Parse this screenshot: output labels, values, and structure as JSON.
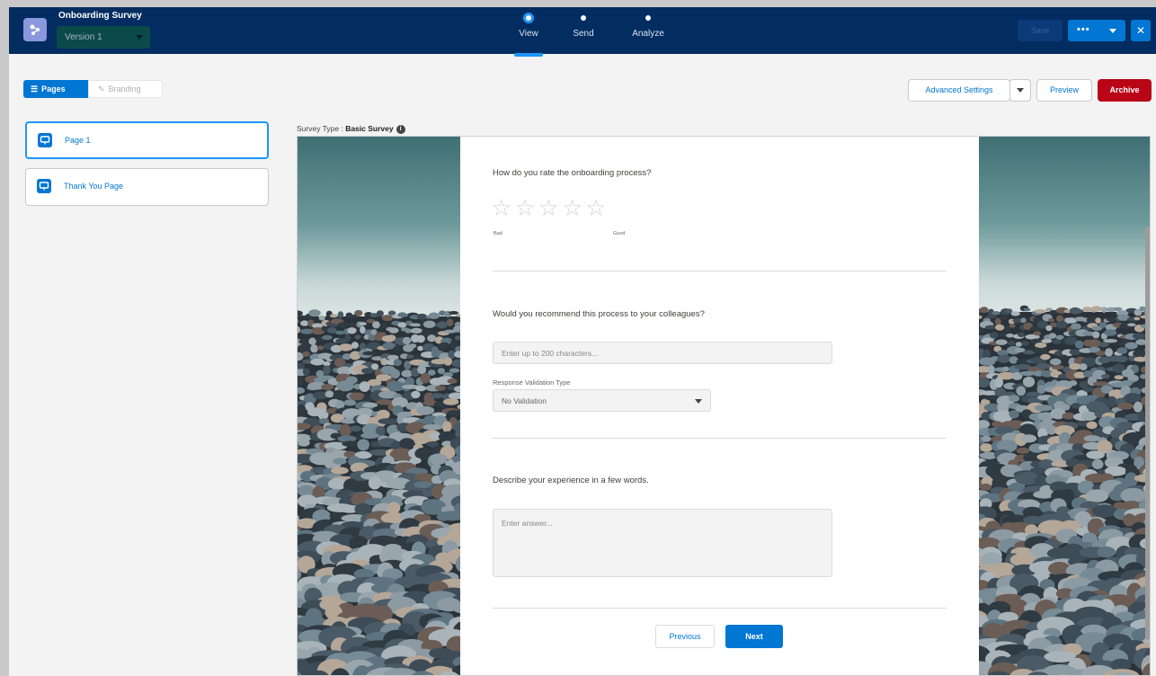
{
  "app": {
    "title": "Onboarding Survey",
    "version": "Version 1"
  },
  "nav": {
    "steps": [
      {
        "label": "View",
        "active": true
      },
      {
        "label": "Send",
        "active": false
      },
      {
        "label": "Analyze",
        "active": false
      }
    ]
  },
  "header_actions": {
    "save_label": "Save",
    "more_label": "•••",
    "close_label": "✕"
  },
  "left_tabs": {
    "pages_label": "Pages",
    "branding_label": "Branding"
  },
  "toolbar": {
    "advanced_settings_label": "Advanced Settings",
    "preview_label": "Preview",
    "archive_label": "Archive"
  },
  "pages": [
    {
      "label": "Page 1",
      "selected": true
    },
    {
      "label": "Thank You Page",
      "selected": false
    }
  ],
  "survey_type": {
    "prefix": "Survey Type : ",
    "value": "Basic Survey",
    "info_glyph": "i"
  },
  "questions": {
    "q1": {
      "text": "How do you rate the onboarding process?",
      "rating_max": 5,
      "rating_value": 0,
      "low_label": "Bad",
      "high_label": "Good"
    },
    "q2": {
      "text": "Would you recommend this process to your colleagues?",
      "placeholder": "Enter up to 200 characters...",
      "validation_label": "Response Validation Type",
      "validation_value": "No Validation"
    },
    "q3": {
      "text": "Describe your experience in a few words.",
      "placeholder": "Enter answer..."
    }
  },
  "form_nav": {
    "previous_label": "Previous",
    "next_label": "Next"
  },
  "colors": {
    "brand_blue": "#0176d3",
    "header_navy": "#032d60",
    "archive_red": "#ba0517"
  }
}
